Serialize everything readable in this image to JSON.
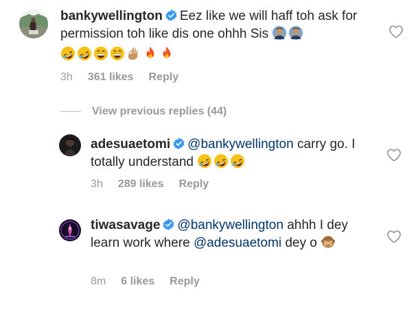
{
  "comments": [
    {
      "username": "bankywellington",
      "text": "Eez like we will haff toh ask for permission toh like dis one ohhh Sis",
      "time": "3h",
      "likes": "361 likes",
      "reply": "Reply"
    },
    {
      "username": "adesuaetomi",
      "mention": "@bankywellington",
      "text": "carry go. I totally understand",
      "time": "3h",
      "likes": "289 likes",
      "reply": "Reply"
    },
    {
      "username": "tiwasavage",
      "mention": "@bankywellington",
      "text_a": "ahhh I dey learn work where",
      "mention2": "@adesuaetomi",
      "text_b": "dey o",
      "time": "8m",
      "likes": "6 likes",
      "reply": "Reply"
    }
  ],
  "view_previous": "View previous replies (44)",
  "colors": {
    "verified": "#3897f0",
    "mention": "#003569",
    "meta": "#999999"
  },
  "icons": [
    "verified-badge-icon",
    "heart-outline-icon",
    "rofl-emoji",
    "grinning-emoji",
    "ok-hand-emoji",
    "fire-emoji",
    "person-gesturing-emoji",
    "see-no-evil-monkey-emoji"
  ]
}
